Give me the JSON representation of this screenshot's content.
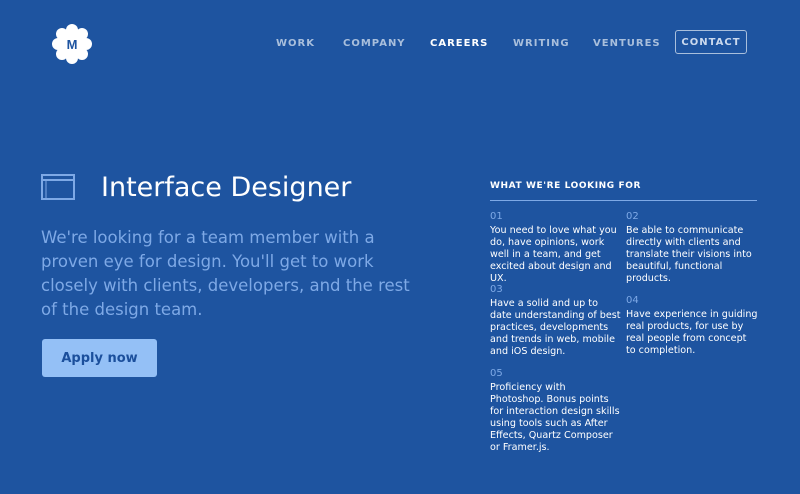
{
  "logo": {
    "letter": "M"
  },
  "nav": {
    "items": [
      {
        "label": "WORK",
        "active": false
      },
      {
        "label": "COMPANY",
        "active": false
      },
      {
        "label": "CAREERS",
        "active": true
      },
      {
        "label": "WRITING",
        "active": false
      },
      {
        "label": "VENTURES",
        "active": false
      }
    ],
    "contact_label": "CONTACT"
  },
  "job": {
    "title": "Interface Designer",
    "intro": "We're looking for a team member with a proven eye for design. You'll get to work closely with clients, developers, and the rest of the design team.",
    "apply_label": "Apply now"
  },
  "requirements": {
    "heading": "WHAT WE'RE LOOKING FOR",
    "items": [
      {
        "number": "01",
        "text": "You need to love what you do, have opinions, work well in a team, and get excited about design and UX."
      },
      {
        "number": "02",
        "text": "Be able to communicate directly with clients and translate their visions into beautiful, functional products."
      },
      {
        "number": "03",
        "text": "Have a solid and up to date understanding of best practices, developments and trends in web, mobile and iOS design."
      },
      {
        "number": "04",
        "text": "Have experience in guiding real products, for use by real people from concept to completion."
      },
      {
        "number": "05",
        "text": "Proficiency with Photoshop. Bonus points for interaction design skills using tools such as After Effects, Quartz Composer or Framer.js."
      }
    ]
  },
  "colors": {
    "background": "#1e54a0",
    "accent_light": "#7ea9e6",
    "button_bg": "#94c0f6",
    "nav_muted": "#a9bfdc"
  }
}
